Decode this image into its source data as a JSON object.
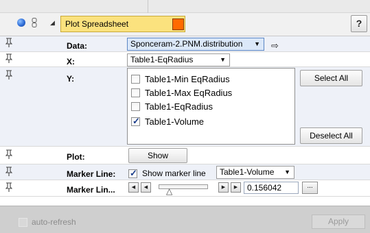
{
  "header": {
    "module_title": "Plot Spreadsheet",
    "help_label": "?",
    "colors": {
      "title_bg": "#fbe27e",
      "swatch": "#ff6a00",
      "viewer_dot": "#2f6ed8"
    }
  },
  "params": {
    "data": {
      "label": "Data:",
      "value": "Sponceram-2.PNM.distribution"
    },
    "x": {
      "label": "X:",
      "value": "Table1-EqRadius"
    },
    "y": {
      "label": "Y:",
      "items": [
        {
          "label": "Table1-Min EqRadius",
          "checked": false
        },
        {
          "label": "Table1-Max EqRadius",
          "checked": false
        },
        {
          "label": "Table1-EqRadius",
          "checked": false
        },
        {
          "label": "Table1-Volume",
          "checked": true
        }
      ],
      "select_all": "Select All",
      "deselect_all": "Deselect All"
    },
    "plot": {
      "label": "Plot:",
      "button": "Show"
    },
    "marker_line": {
      "label": "Marker Line:",
      "checkbox_label": "Show marker line",
      "checked": true,
      "value": "Table1-Volume"
    },
    "marker_line_pos": {
      "label": "Marker Lin...",
      "value": "0.156042",
      "more": "..."
    }
  },
  "footer": {
    "auto_refresh": "auto-refresh",
    "apply": "Apply"
  }
}
